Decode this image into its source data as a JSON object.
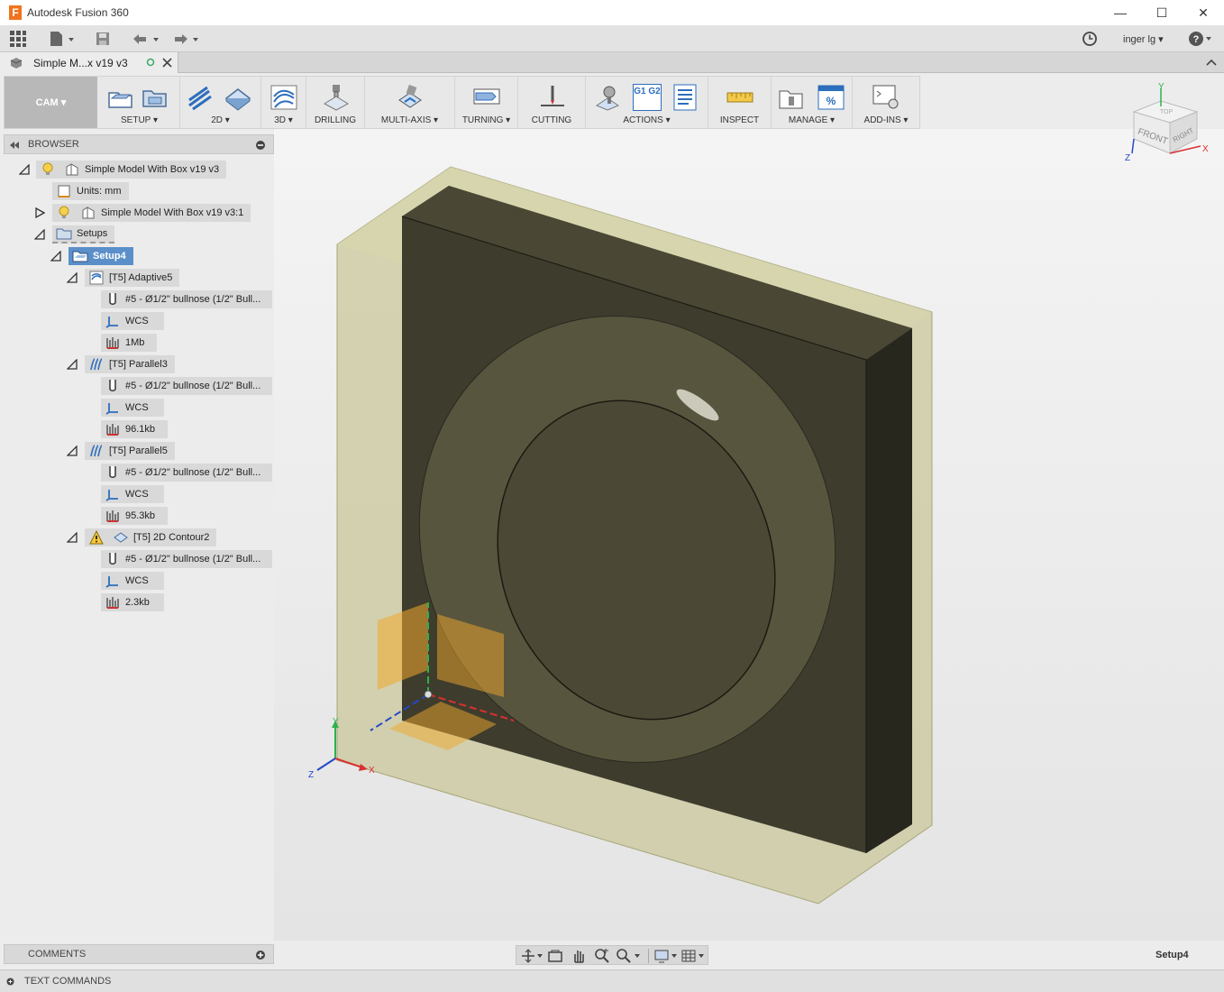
{
  "app": {
    "title": "Autodesk Fusion 360",
    "logo_letter": "F"
  },
  "qat": {
    "user": "inger lg",
    "help": "?"
  },
  "doc_tab": {
    "title": "Simple M...x v19 v3"
  },
  "toolbar": {
    "workspace": "CAM ▾",
    "groups": {
      "setup": "SETUP ▾",
      "two_d": "2D ▾",
      "three_d": "3D ▾",
      "drilling": "DRILLING",
      "multi_axis": "MULTI-AXIS ▾",
      "turning": "TURNING ▾",
      "cutting": "CUTTING",
      "actions": "ACTIONS ▾",
      "inspect": "INSPECT",
      "manage": "MANAGE ▾",
      "add_ins": "ADD-INS ▾"
    },
    "gcode_icon": "G1 G2"
  },
  "viewcube": {
    "top": "TOP",
    "front": "FRONT",
    "right": "RIGHT",
    "x": "X",
    "y": "Y",
    "z": "Z"
  },
  "browser": {
    "title": "BROWSER",
    "root": "Simple Model With Box v19 v3",
    "units": "Units: mm",
    "component": "Simple Model With Box v19 v3:1",
    "setups": "Setups",
    "setup": "Setup4",
    "ops": [
      {
        "name": "[T5] Adaptive5",
        "tool": "#5 - Ø1/2\" bullnose (1/2\" Bull...",
        "wcs": "WCS",
        "size": "1Mb"
      },
      {
        "name": "[T5] Parallel3",
        "tool": "#5 - Ø1/2\" bullnose (1/2\" Bull...",
        "wcs": "WCS",
        "size": "96.1kb"
      },
      {
        "name": "[T5] Parallel5",
        "tool": "#5 - Ø1/2\" bullnose (1/2\" Bull...",
        "wcs": "WCS",
        "size": "95.3kb"
      },
      {
        "name": "[T5] 2D Contour2",
        "tool": "#5 - Ø1/2\" bullnose (1/2\" Bull...",
        "wcs": "WCS",
        "size": "2.3kb"
      }
    ]
  },
  "triad": {
    "x": "X",
    "y": "Y",
    "z": "Z"
  },
  "comments": {
    "title": "COMMENTS"
  },
  "status": {
    "active_setup": "Setup4"
  },
  "text_commands": {
    "title": "TEXT COMMANDS"
  }
}
